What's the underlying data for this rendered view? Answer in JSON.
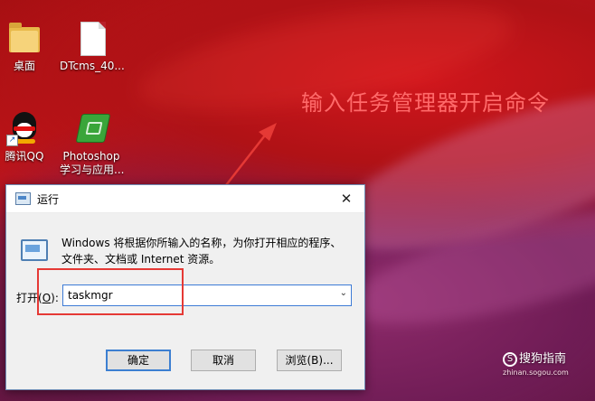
{
  "desktop": {
    "icons": [
      {
        "label": "桌面",
        "icon": "folder-icon"
      },
      {
        "label": "DTcms_40...",
        "icon": "file-icon"
      },
      {
        "label": "腾讯QQ",
        "icon": "qq-icon"
      },
      {
        "label": "Photoshop",
        "label2": "学习与应用...",
        "icon": "book-icon"
      }
    ]
  },
  "annotation": {
    "text": "输入任务管理器开启命令",
    "color": "#ff6a6a"
  },
  "dialog": {
    "title": "运行",
    "close": "✕",
    "description": "Windows 将根据你所输入的名称，为你打开相应的程序、文件夹、文档或 Internet 资源。",
    "open_label_prefix": "打开(",
    "open_label_key": "O",
    "open_label_suffix": "):",
    "input_value": "taskmgr",
    "dropdown_glyph": "⌄",
    "buttons": {
      "ok": "确定",
      "cancel": "取消",
      "browse": "浏览(B)..."
    }
  },
  "watermark": {
    "text": "搜狗指南",
    "logo": "S",
    "url": "zhinan.sogou.com"
  },
  "colors": {
    "accent": "#3c7fd1",
    "highlight": "#e53935"
  }
}
